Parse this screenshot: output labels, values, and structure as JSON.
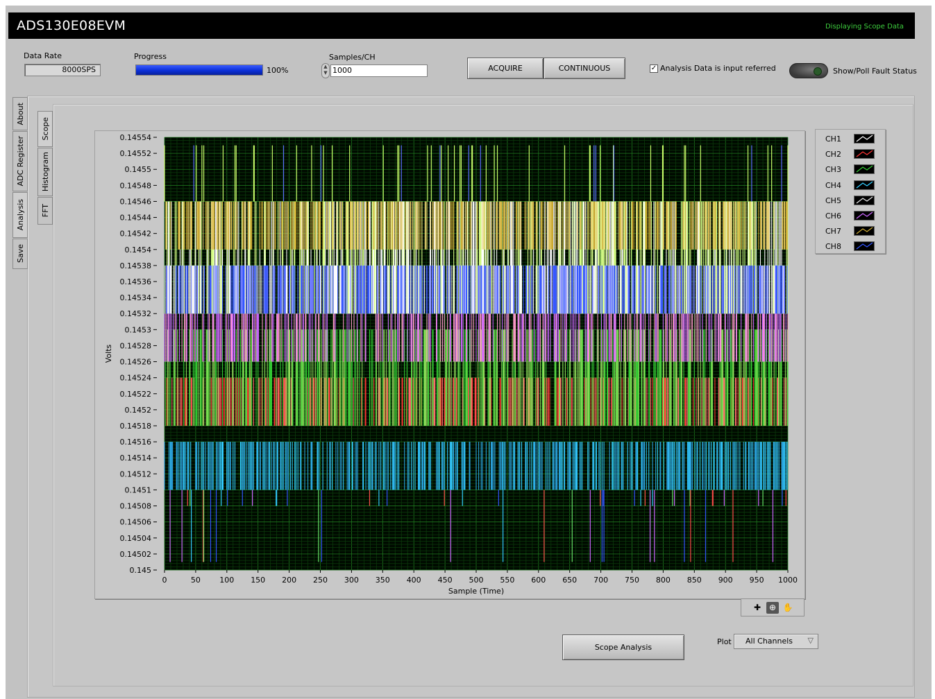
{
  "app": {
    "title": "ADS130E08EVM",
    "status_text": "Displaying Scope Data"
  },
  "controls": {
    "data_rate_label": "Data Rate",
    "data_rate_value": "8000SPS",
    "progress_label": "Progress",
    "progress_percent": 100,
    "progress_text": "100%",
    "samples_label": "Samples/CH",
    "samples_value": "1000",
    "acquire_label": "ACQUIRE",
    "continuous_label": "CONTINUOUS",
    "analysis_checkbox_label": "Analysis Data is input referred",
    "analysis_checked": true,
    "fault_label": "Show/Poll Fault Status"
  },
  "side_tabs": [
    "About",
    "ADC Register",
    "Analysis",
    "Save"
  ],
  "sub_tabs": [
    "Scope",
    "Histogram",
    "FFT"
  ],
  "legend": [
    {
      "name": "CH1",
      "color": "#ffffff"
    },
    {
      "name": "CH2",
      "color": "#ff3333"
    },
    {
      "name": "CH3",
      "color": "#33cc33"
    },
    {
      "name": "CH4",
      "color": "#33ccff"
    },
    {
      "name": "CH5",
      "color": "#e8e8e8"
    },
    {
      "name": "CH6",
      "color": "#cc66ff"
    },
    {
      "name": "CH7",
      "color": "#ccaa33"
    },
    {
      "name": "CH8",
      "color": "#3355ff"
    }
  ],
  "bottom": {
    "scope_analysis_label": "Scope Analysis",
    "plot_label": "Plot",
    "plot_value": "All Channels"
  },
  "chart_data": {
    "type": "line",
    "xlabel": "Sample (Time)",
    "ylabel": "Volts",
    "xlim": [
      0,
      1000
    ],
    "ylim": [
      0.145,
      0.14554
    ],
    "x_ticks": [
      "0",
      "50",
      "100",
      "150",
      "200",
      "250",
      "300",
      "350",
      "400",
      "450",
      "500",
      "550",
      "600",
      "650",
      "700",
      "750",
      "800",
      "850",
      "900",
      "950",
      "1000"
    ],
    "y_ticks": [
      "0.14554",
      "0.14552",
      "0.1455",
      "0.14548",
      "0.14546",
      "0.14544",
      "0.14542",
      "0.1454",
      "0.14538",
      "0.14536",
      "0.14534",
      "0.14532",
      "0.1453",
      "0.14528",
      "0.14526",
      "0.14524",
      "0.14522",
      "0.1452",
      "0.14518",
      "0.14516",
      "0.14514",
      "0.14512",
      "0.1451",
      "0.14508",
      "0.14506",
      "0.14504",
      "0.14502",
      "0.145"
    ],
    "grid": true,
    "series": [
      {
        "name": "CH1",
        "band": [
          0.14532,
          0.14538
        ]
      },
      {
        "name": "CH2",
        "band": [
          0.14518,
          0.14524
        ]
      },
      {
        "name": "CH3",
        "band": [
          0.14518,
          0.1453
        ]
      },
      {
        "name": "CH4",
        "band": [
          0.1451,
          0.14516
        ]
      },
      {
        "name": "CH5",
        "band": [
          0.14532,
          0.14546
        ]
      },
      {
        "name": "CH6",
        "band": [
          0.14526,
          0.14532
        ]
      },
      {
        "name": "CH7",
        "band": [
          0.1454,
          0.14546
        ]
      },
      {
        "name": "CH8",
        "band": [
          0.14532,
          0.14538
        ]
      }
    ]
  }
}
